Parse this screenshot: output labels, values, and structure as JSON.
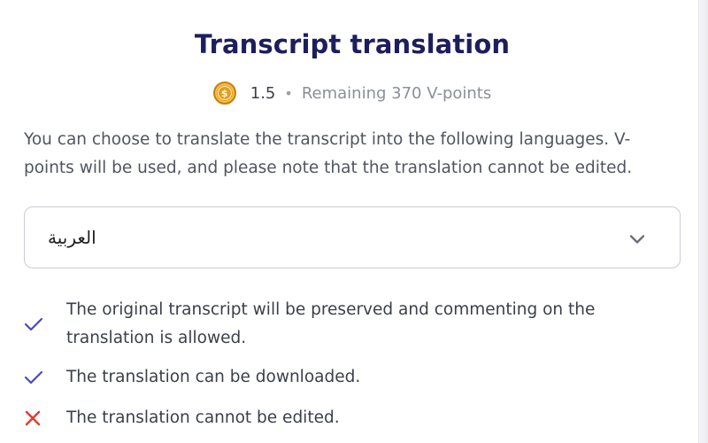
{
  "dialog": {
    "title": "Transcript translation",
    "cost": "1.5",
    "separator": "•",
    "remaining": "Remaining 370 V-points",
    "description": "You can choose to translate the transcript into the following languages. V-points will be used, and please note that the translation cannot be edited."
  },
  "language_select": {
    "selected": "العربية"
  },
  "features": [
    {
      "icon": "check-icon",
      "text": "The original transcript will be preserved and commenting on the translation is allowed."
    },
    {
      "icon": "check-icon",
      "text": "The translation can be downloaded."
    },
    {
      "icon": "cross-icon",
      "text": "The translation cannot be edited."
    }
  ],
  "colors": {
    "title": "#1d1e5e",
    "check": "#4b46c8",
    "cross": "#e23b2e",
    "coin": "#e39d1c"
  }
}
